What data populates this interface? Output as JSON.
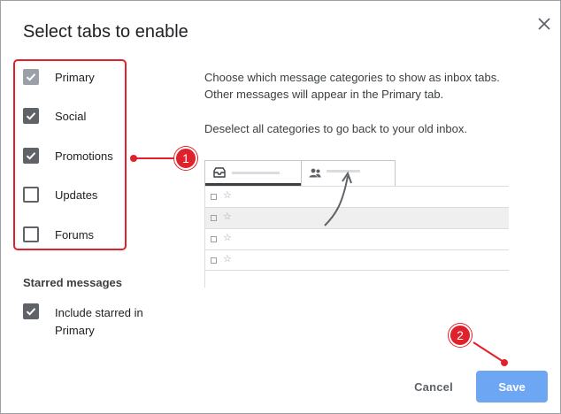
{
  "dialog": {
    "title": "Select tabs to enable"
  },
  "categories": [
    {
      "label": "Primary",
      "checked": true,
      "disabled": true
    },
    {
      "label": "Social",
      "checked": true,
      "disabled": false
    },
    {
      "label": "Promotions",
      "checked": true,
      "disabled": false
    },
    {
      "label": "Updates",
      "checked": false,
      "disabled": false
    },
    {
      "label": "Forums",
      "checked": false,
      "disabled": false
    }
  ],
  "starred": {
    "heading": "Starred messages",
    "option_label": "Include starred in Primary",
    "checked": true
  },
  "description": {
    "line1": "Choose which message categories to show as inbox tabs. Other messages will appear in the Primary tab.",
    "line2": "Deselect all categories to go back to your old inbox."
  },
  "preview": {
    "tab_icons": [
      "inbox-icon",
      "people-icon"
    ],
    "row_count": 4
  },
  "annotations": {
    "marker1": "1",
    "marker2": "2",
    "color": "#e0202a"
  },
  "buttons": {
    "cancel": "Cancel",
    "save": "Save",
    "save_color": "#6da6f2"
  },
  "icons": {
    "close": "close-icon"
  }
}
